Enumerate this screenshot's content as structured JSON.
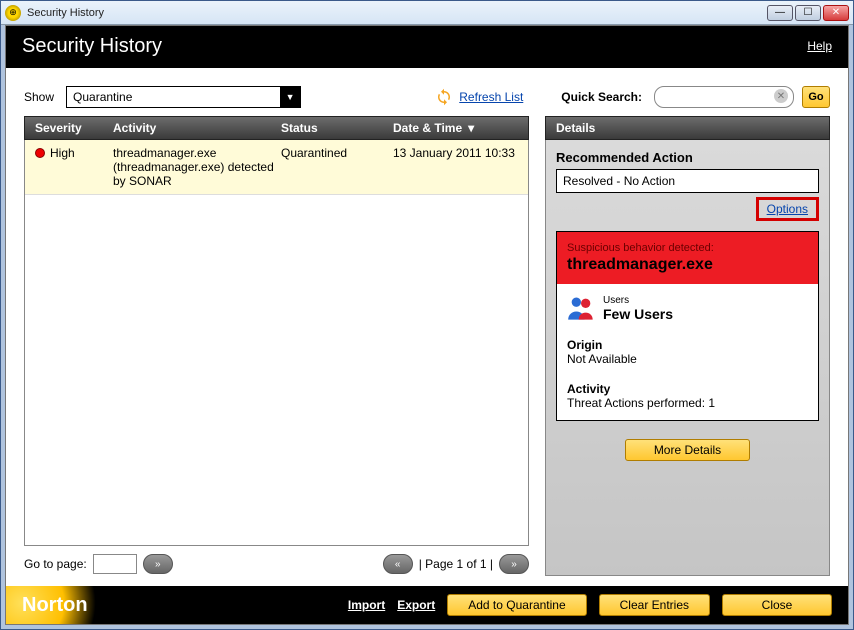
{
  "window": {
    "title": "Security History"
  },
  "header": {
    "title": "Security History",
    "help": "Help"
  },
  "filter": {
    "show_label": "Show",
    "selected": "Quarantine",
    "refresh_label": "Refresh List",
    "quick_search_label": "Quick Search:",
    "quick_search_value": "",
    "go_label": "Go"
  },
  "table": {
    "headers": {
      "severity": "Severity",
      "activity": "Activity",
      "status": "Status",
      "datetime": "Date & Time"
    },
    "rows": [
      {
        "severity": "High",
        "activity": "threadmanager.exe (threadmanager.exe) detected by SONAR",
        "status": "Quarantined",
        "datetime": "13 January 2011 10:33"
      }
    ]
  },
  "pager": {
    "goto_label": "Go to page:",
    "page_value": "",
    "page_text": "| Page 1 of 1 |"
  },
  "details": {
    "heading": "Details",
    "recommended_label": "Recommended Action",
    "recommended_value": "Resolved - No Action",
    "options": "Options",
    "alert_line1": "Suspicious behavior detected:",
    "alert_line2": "threadmanager.exe",
    "users_small": "Users",
    "users_big": "Few Users",
    "origin_h": "Origin",
    "origin_v": "Not Available",
    "activity_h": "Activity",
    "activity_v": "Threat Actions performed: 1",
    "more": "More Details"
  },
  "bottom": {
    "brand": "Norton",
    "import": "Import",
    "export": "Export",
    "add": "Add to Quarantine",
    "clear": "Clear Entries",
    "close": "Close"
  }
}
